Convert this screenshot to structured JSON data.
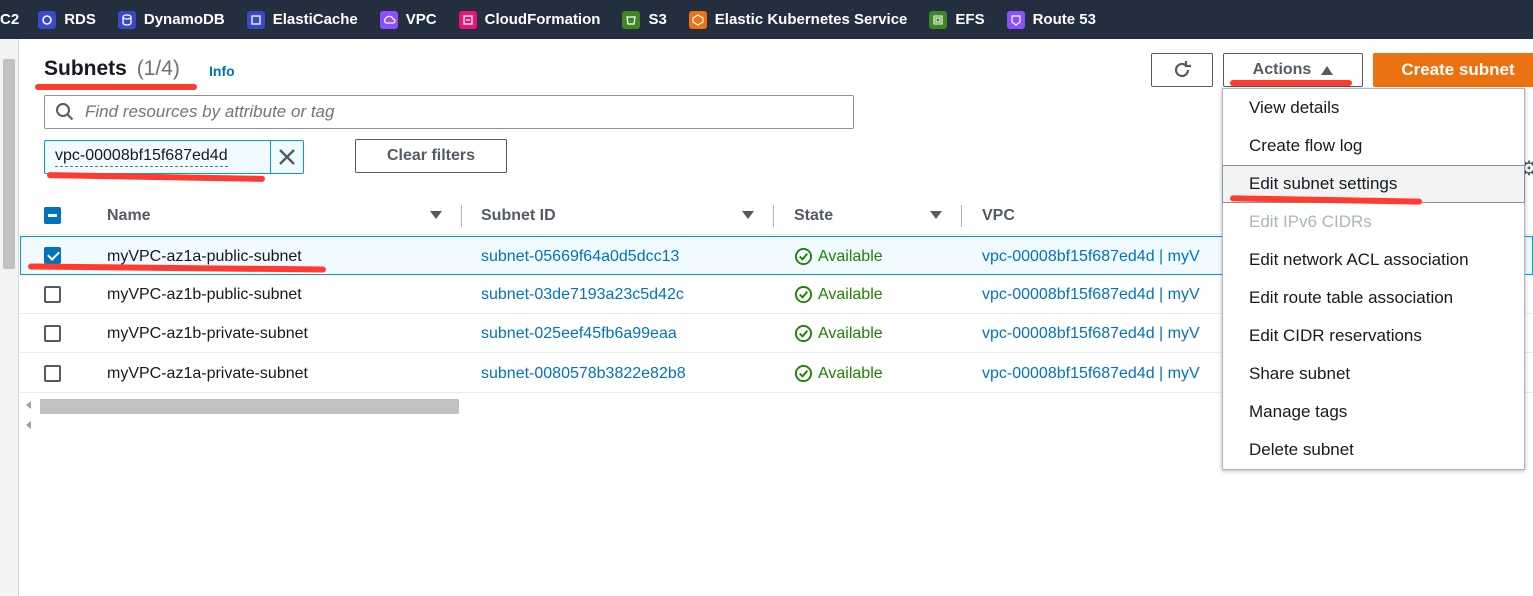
{
  "services_bar": [
    {
      "label": "C2",
      "icon": "ec2-icon",
      "color": "#ec7211"
    },
    {
      "label": "RDS",
      "icon": "rds-icon",
      "color": "#3b48cc"
    },
    {
      "label": "DynamoDB",
      "icon": "dynamodb-icon",
      "color": "#3b48cc"
    },
    {
      "label": "ElastiCache",
      "icon": "elasticache-icon",
      "color": "#3b48cc"
    },
    {
      "label": "VPC",
      "icon": "vpc-icon",
      "color": "#8c4fff"
    },
    {
      "label": "CloudFormation",
      "icon": "cloudformation-icon",
      "color": "#e7157b"
    },
    {
      "label": "S3",
      "icon": "s3-icon",
      "color": "#3f8624"
    },
    {
      "label": "Elastic Kubernetes Service",
      "icon": "eks-icon",
      "color": "#ec7211"
    },
    {
      "label": "EFS",
      "icon": "efs-icon",
      "color": "#3f8624"
    },
    {
      "label": "Route 53",
      "icon": "route53-icon",
      "color": "#8c4fff"
    }
  ],
  "header": {
    "title": "Subnets",
    "count": "(1/4)",
    "info": "Info"
  },
  "search": {
    "placeholder": "Find resources by attribute or tag"
  },
  "filter_token": {
    "value": "vpc-00008bf15f687ed4d"
  },
  "buttons": {
    "clear_filters": "Clear filters",
    "actions": "Actions",
    "create_subnet": "Create subnet"
  },
  "table": {
    "columns": [
      "Name",
      "Subnet ID",
      "State",
      "VPC"
    ],
    "rows": [
      {
        "name": "myVPC-az1a-public-subnet",
        "subnet_id": "subnet-05669f64a0d5dcc13",
        "state": "Available",
        "vpc": "vpc-00008bf15f687ed4d | myV",
        "selected": true
      },
      {
        "name": "myVPC-az1b-public-subnet",
        "subnet_id": "subnet-03de7193a23c5d42c",
        "state": "Available",
        "vpc": "vpc-00008bf15f687ed4d | myV",
        "selected": false
      },
      {
        "name": "myVPC-az1b-private-subnet",
        "subnet_id": "subnet-025eef45fb6a99eaa",
        "state": "Available",
        "vpc": "vpc-00008bf15f687ed4d | myV",
        "selected": false
      },
      {
        "name": "myVPC-az1a-private-subnet",
        "subnet_id": "subnet-0080578b3822e82b8",
        "state": "Available",
        "vpc": "vpc-00008bf15f687ed4d | myV",
        "selected": false
      }
    ]
  },
  "actions_menu": [
    {
      "label": "View details",
      "state": "normal"
    },
    {
      "label": "Create flow log",
      "state": "normal"
    },
    {
      "label": "Edit subnet settings",
      "state": "hover"
    },
    {
      "label": "Edit IPv6 CIDRs",
      "state": "disabled"
    },
    {
      "label": "Edit network ACL association",
      "state": "normal"
    },
    {
      "label": "Edit route table association",
      "state": "normal"
    },
    {
      "label": "Edit CIDR reservations",
      "state": "normal"
    },
    {
      "label": "Share subnet",
      "state": "normal"
    },
    {
      "label": "Manage tags",
      "state": "normal"
    },
    {
      "label": "Delete subnet",
      "state": "normal"
    }
  ],
  "colors": {
    "topbar": "#232f3e",
    "link": "#0073bb",
    "success": "#1d8102",
    "primary": "#ec7211",
    "annotation": "#ff3b30"
  }
}
